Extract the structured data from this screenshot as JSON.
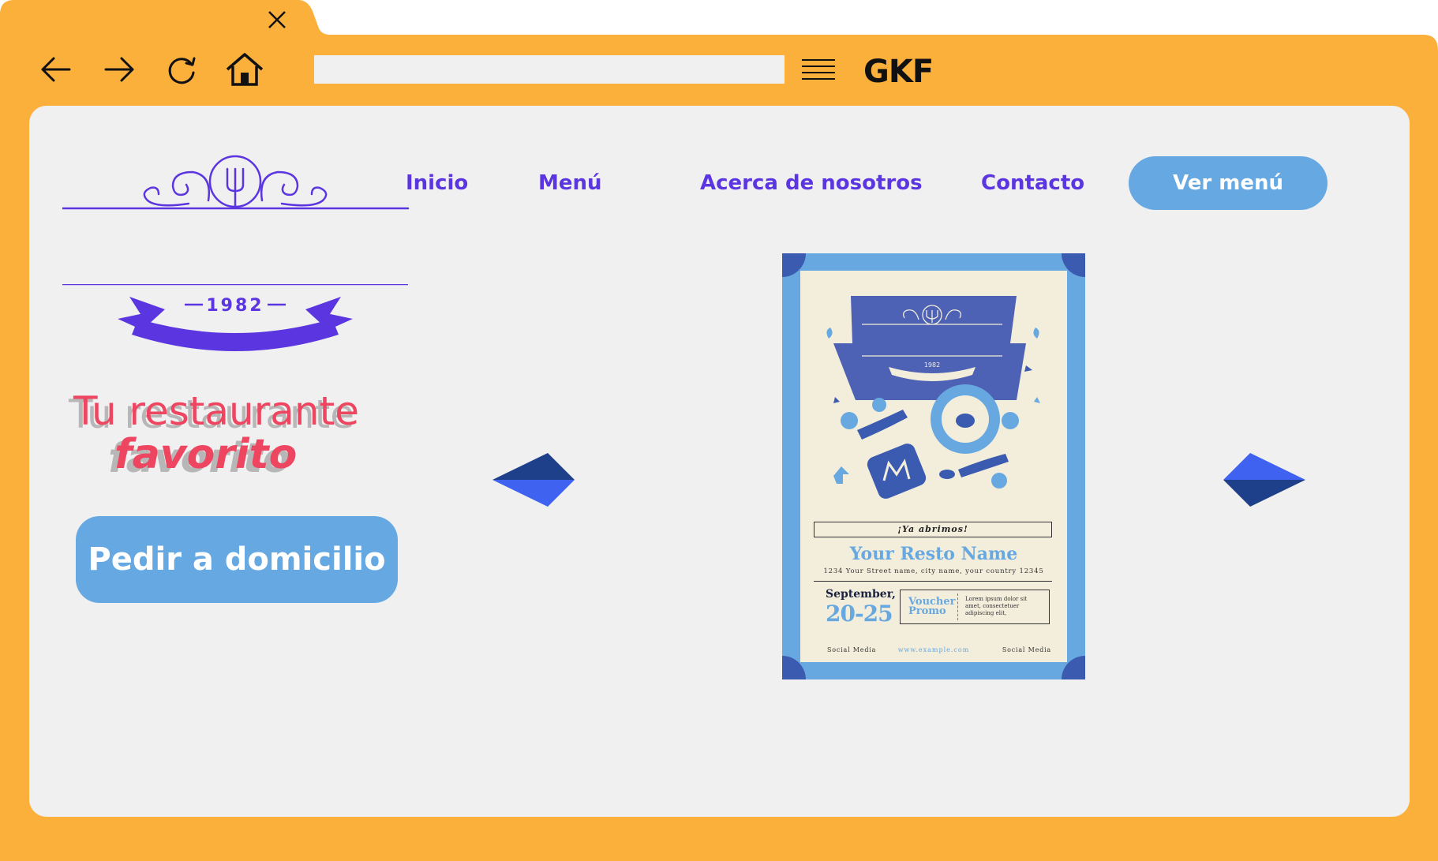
{
  "browser": {
    "brand": "GKF",
    "address_value": "",
    "colors": {
      "frame": "#fbb03b",
      "viewport": "#f0f0f0"
    }
  },
  "site": {
    "logo": {
      "year": "1982"
    },
    "nav": [
      {
        "label": "Inicio"
      },
      {
        "label": "Menú"
      },
      {
        "label": "Acerca de nosotros"
      },
      {
        "label": "Contacto"
      }
    ],
    "cta_label": "Ver menú",
    "headline_line1": "Tu restaurante",
    "headline_line2": "favorito",
    "order_button": "Pedir a domicilio",
    "colors": {
      "nav": "#5b36e0",
      "button": "#66a8e2",
      "headline": "#ee4560"
    }
  },
  "flyer": {
    "year": "1982",
    "opening": "¡Ya abrimos!",
    "resto_name": "Your Resto Name",
    "address": "1234 Your Street name, city name, your country 12345",
    "month": "September,",
    "dates": "20-25",
    "voucher_line1": "Voucher",
    "voucher_line2": "Promo",
    "lorem_line1": "Lorem ipsum dolor sit",
    "lorem_line2": "amet, consectetuer",
    "lorem_line3": "adipiscing elit,",
    "social_left": "Social Media",
    "website": "www.example.com",
    "social_right": "Social Media"
  },
  "icons": [
    "close-icon",
    "back-arrow-icon",
    "forward-arrow-icon",
    "reload-icon",
    "home-icon",
    "hamburger-menu-icon"
  ]
}
